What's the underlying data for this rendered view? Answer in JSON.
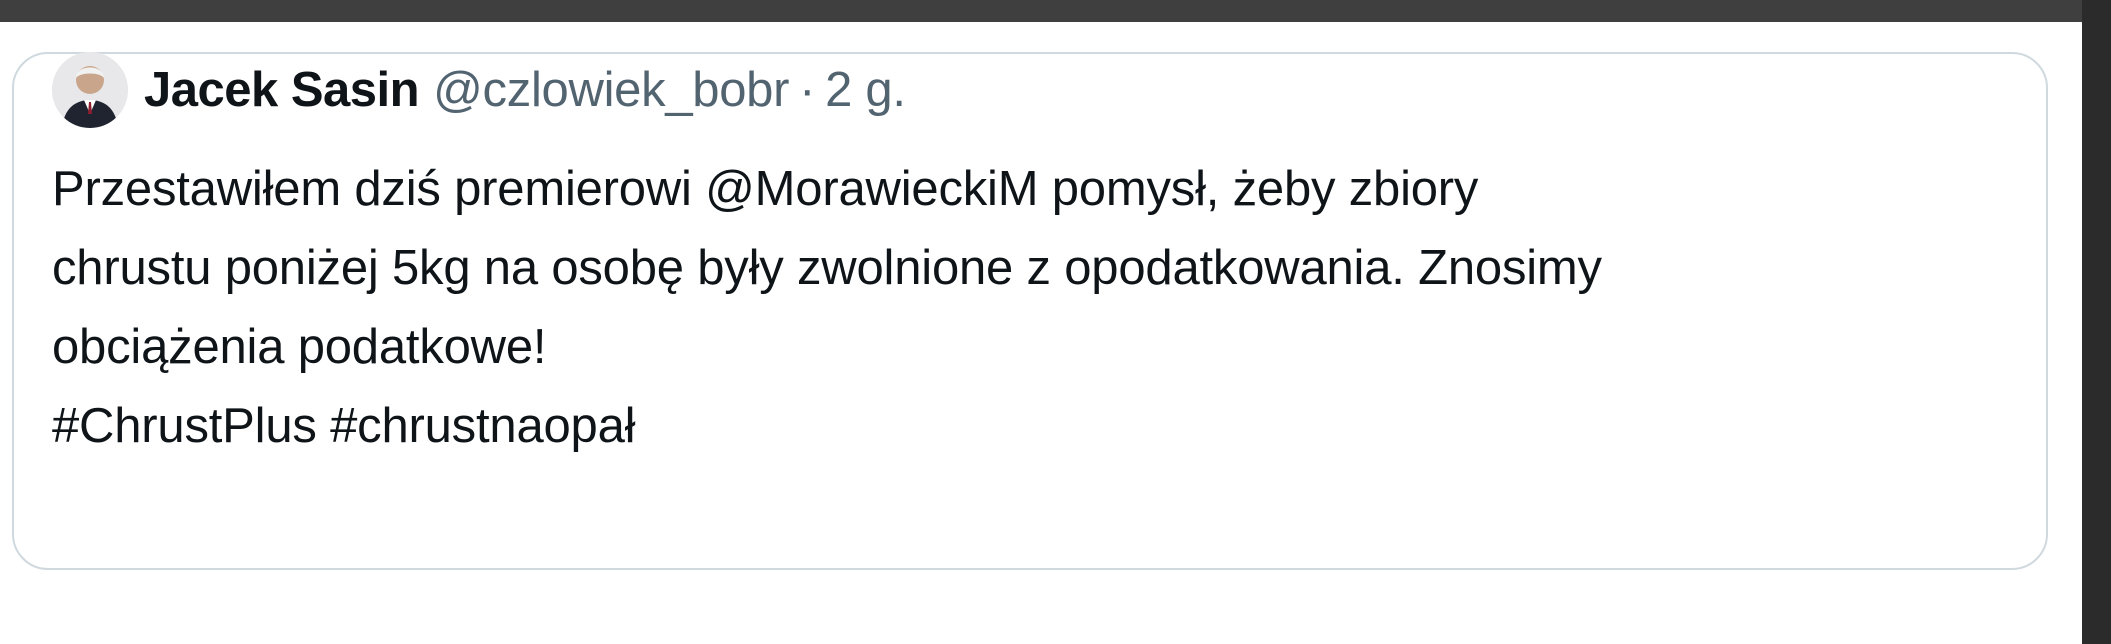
{
  "tweet": {
    "author_name": "Jacek Sasin",
    "handle": "@czlowiek_bobr",
    "separator": "·",
    "time": "2 g.",
    "lines": [
      "Przestawiłem dziś premierowi @MorawieckiM pomysł, żeby zbiory",
      "chrustu poniżej 5kg na osobę były zwolnione z opodatkowania. Znosimy",
      "obciążenia podatkowe!",
      "#ChrustPlus #chrustnaopał"
    ]
  },
  "colors": {
    "top_bar": "#3f3f3f",
    "right_strip": "#2b2b2b",
    "card_border": "#cfd9de",
    "text_primary": "#0f1419",
    "text_secondary": "#536471"
  },
  "icons": {
    "avatar": "profile-photo-avatar-icon"
  }
}
